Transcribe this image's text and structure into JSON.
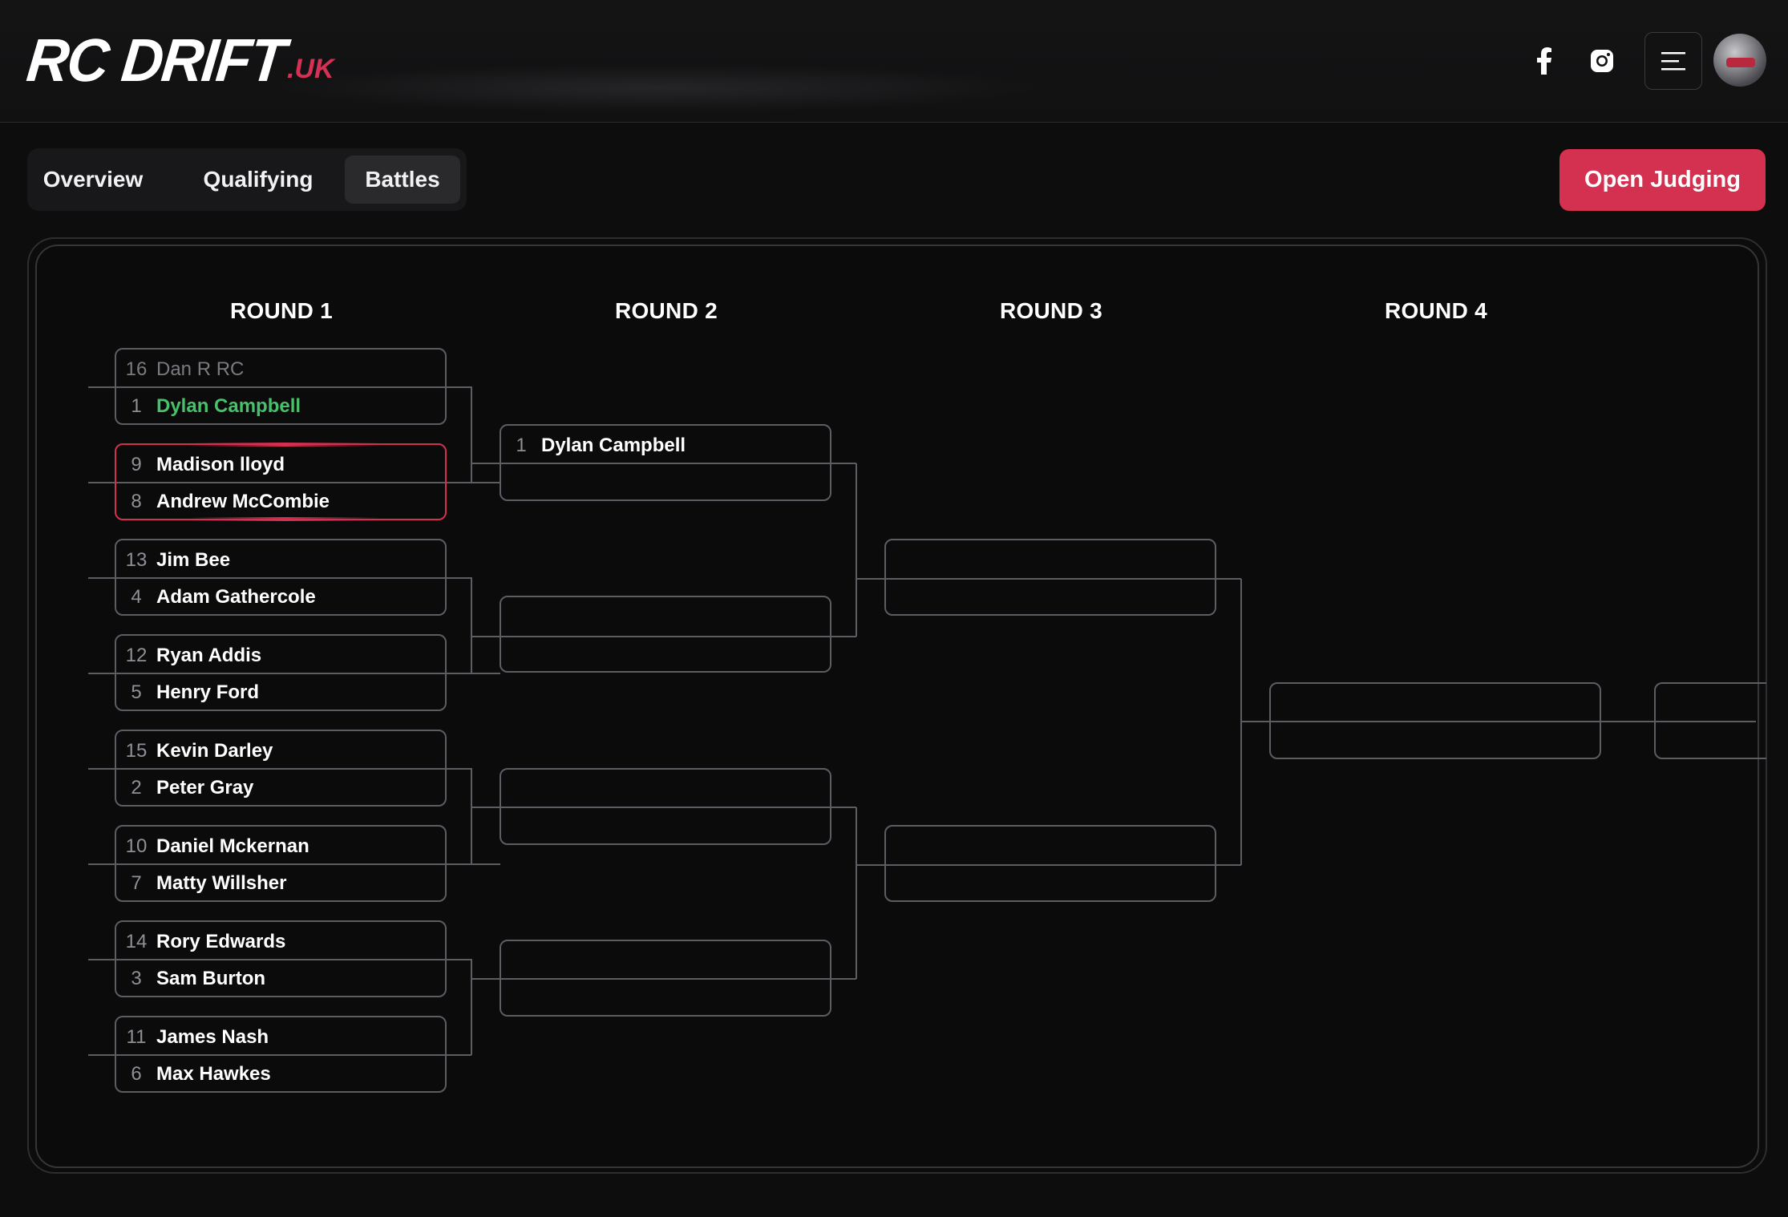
{
  "brand": {
    "main": "RC DRIFT",
    "suffix": ".UK",
    "accent": "#d4304f"
  },
  "header": {
    "icons": [
      "facebook-icon",
      "instagram-icon",
      "menu-icon",
      "avatar"
    ]
  },
  "tabs": [
    {
      "label": "Overview",
      "active": false
    },
    {
      "label": "Qualifying",
      "active": false
    },
    {
      "label": "Battles",
      "active": true
    }
  ],
  "actions": {
    "open_judging": "Open Judging"
  },
  "rounds": [
    "ROUND 1",
    "ROUND 2",
    "ROUND 3",
    "ROUND 4"
  ],
  "round1": [
    {
      "a": {
        "seed": "16",
        "name": "Dan R RC",
        "state": "eliminated"
      },
      "b": {
        "seed": "1",
        "name": "Dylan Campbell",
        "state": "winner"
      }
    },
    {
      "a": {
        "seed": "9",
        "name": "Madison lloyd"
      },
      "b": {
        "seed": "8",
        "name": "Andrew McCombie"
      },
      "status": "active"
    },
    {
      "a": {
        "seed": "13",
        "name": "Jim Bee"
      },
      "b": {
        "seed": "4",
        "name": "Adam Gathercole"
      }
    },
    {
      "a": {
        "seed": "12",
        "name": "Ryan Addis"
      },
      "b": {
        "seed": "5",
        "name": "Henry Ford"
      }
    },
    {
      "a": {
        "seed": "15",
        "name": "Kevin Darley"
      },
      "b": {
        "seed": "2",
        "name": "Peter Gray"
      }
    },
    {
      "a": {
        "seed": "10",
        "name": "Daniel Mckernan"
      },
      "b": {
        "seed": "7",
        "name": "Matty Willsher"
      }
    },
    {
      "a": {
        "seed": "14",
        "name": "Rory Edwards"
      },
      "b": {
        "seed": "3",
        "name": "Sam Burton"
      }
    },
    {
      "a": {
        "seed": "11",
        "name": "James Nash"
      },
      "b": {
        "seed": "6",
        "name": "Max Hawkes"
      }
    }
  ],
  "round2": [
    {
      "a": {
        "seed": "1",
        "name": "Dylan Campbell"
      },
      "b": {
        "seed": "",
        "name": ""
      }
    },
    {
      "a": {
        "seed": "",
        "name": ""
      },
      "b": {
        "seed": "",
        "name": ""
      }
    },
    {
      "a": {
        "seed": "",
        "name": ""
      },
      "b": {
        "seed": "",
        "name": ""
      }
    },
    {
      "a": {
        "seed": "",
        "name": ""
      },
      "b": {
        "seed": "",
        "name": ""
      }
    }
  ],
  "round3": [
    {
      "a": {
        "seed": "",
        "name": ""
      },
      "b": {
        "seed": "",
        "name": ""
      }
    },
    {
      "a": {
        "seed": "",
        "name": ""
      },
      "b": {
        "seed": "",
        "name": ""
      }
    }
  ],
  "round4": [
    {
      "a": {
        "seed": "",
        "name": ""
      },
      "b": {
        "seed": "",
        "name": ""
      }
    }
  ],
  "final": [
    {
      "a": {
        "seed": "",
        "name": ""
      },
      "b": {
        "seed": "",
        "name": ""
      }
    }
  ]
}
